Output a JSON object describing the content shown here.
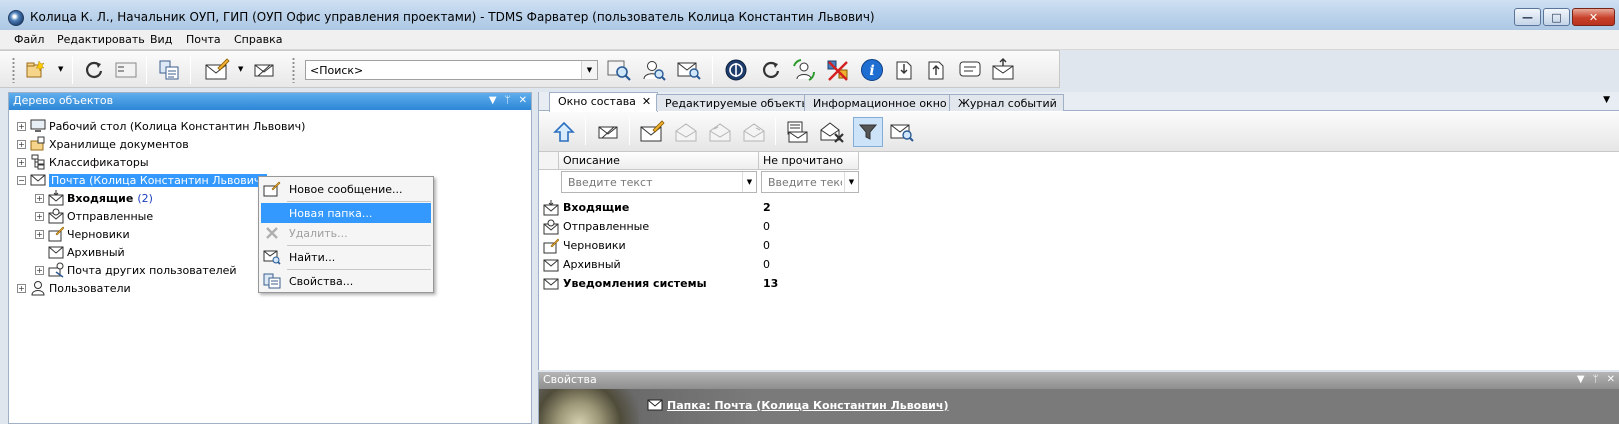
{
  "window": {
    "title": "Колица К. Л., Начальник ОУП, ГИП (ОУП Офис управления проектами) - TDMS Фарватер (пользователь Колица Константин Львович)",
    "minimize": "—",
    "maximize": "□",
    "close": "✕"
  },
  "menu": [
    "Файл",
    "Редактировать",
    "Вид",
    "Почта",
    "Справка"
  ],
  "toolbar": {
    "search_placeholder": "<Поиск>",
    "dropdown_arrow": "▼"
  },
  "left_panel": {
    "title": "Дерево объектов",
    "header_controls": [
      "▼",
      "ᛘ",
      "✕"
    ],
    "tree": [
      {
        "label": "Рабочий стол (Колица Константин Львович)",
        "expander": "+"
      },
      {
        "label": "Хранилище документов",
        "expander": "+"
      },
      {
        "label": "Классификаторы",
        "expander": "+"
      },
      {
        "label": "Почта (Колица Константин Львович)",
        "expander": "−"
      },
      {
        "label": "Входящие",
        "expander": "+",
        "count": "(2)"
      },
      {
        "label": "Отправленные",
        "expander": "+"
      },
      {
        "label": "Черновики",
        "expander": "+"
      },
      {
        "label": "Архивный",
        "expander": ""
      },
      {
        "label": "Почта других пользователей",
        "expander": "+"
      },
      {
        "label": "Пользователи",
        "expander": "+"
      }
    ]
  },
  "context_menu": {
    "items": [
      {
        "label": "Новое сообщение..."
      },
      {
        "label": "Новая папка..."
      },
      {
        "label": "Удалить..."
      },
      {
        "label": "Найти..."
      },
      {
        "label": "Свойства..."
      }
    ]
  },
  "right_panel": {
    "tabs": [
      {
        "label": "Окно состава",
        "close": "✕"
      },
      {
        "label": "Редактируемые объекты"
      },
      {
        "label": "Информационное окно"
      },
      {
        "label": "Журнал событий"
      }
    ],
    "tabs_menu_arrow": "▼",
    "columns": [
      "Описание",
      "Не прочитано"
    ],
    "filter_placeholders": [
      "Введите текст",
      "Введите текс"
    ],
    "filter_arrow": "▼",
    "rows": [
      {
        "name": "Входящие",
        "value": "2",
        "bold": true
      },
      {
        "name": "Отправленные",
        "value": "0",
        "bold": false
      },
      {
        "name": "Черновики",
        "value": "0",
        "bold": false
      },
      {
        "name": "Архивный",
        "value": "0",
        "bold": false
      },
      {
        "name": "Уведомления системы",
        "value": "13",
        "bold": true
      }
    ]
  },
  "properties": {
    "title": "Свойства",
    "header_controls": [
      "▼",
      "ᛘ",
      "✕"
    ],
    "link": "Папка: Почта (Колица Константин Львович)"
  },
  "colors": {
    "selection": "#3399ff",
    "panel_header": "#2d86d6",
    "count_blue": "#1d3fbf"
  }
}
